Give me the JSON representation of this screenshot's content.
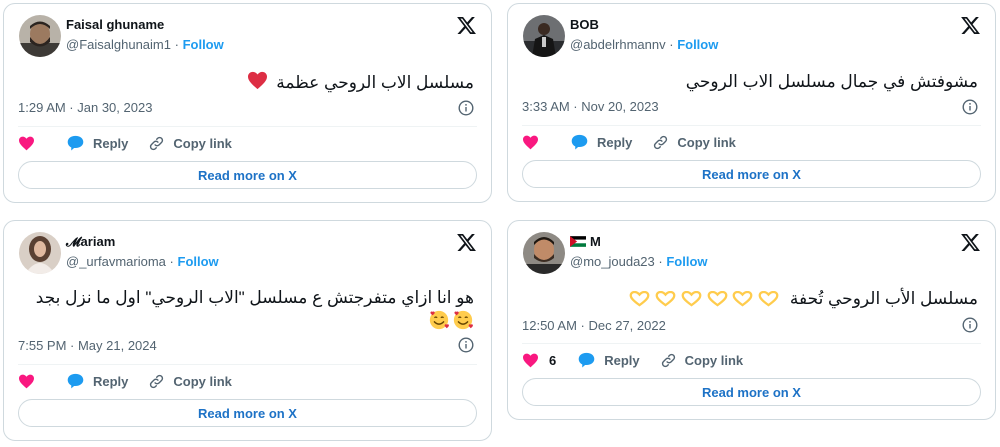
{
  "colors": {
    "heart": "#f91880",
    "reply_bubble": "#1d9bf0",
    "link": "#1d9bf0",
    "read_more_text": "#1d72c6",
    "muted": "#536471",
    "border": "#cfd9de"
  },
  "tweets": [
    {
      "name": "Faisal ghuname",
      "handle": "@Faisalghunaim1",
      "separator": "·",
      "follow": "Follow",
      "text": "مسلسل الاب الروحي عظمة",
      "emoji": "red-heart-emoji",
      "datetime": "1:29 AM · Jan 30, 2023",
      "likes": "",
      "reply": "Reply",
      "copy_link": "Copy link",
      "read_more": "Read more on X"
    },
    {
      "name": "BOB",
      "handle": "@abdelrhmannv",
      "separator": "·",
      "follow": "Follow",
      "text": "مشوفتش في جمال مسلسل الاب الروحي",
      "datetime": "3:33 AM · Nov 20, 2023",
      "likes": "",
      "reply": "Reply",
      "copy_link": "Copy link",
      "read_more": "Read more on X"
    },
    {
      "name": "𝓜ariam",
      "handle": "@_urfavmarioma",
      "separator": "·",
      "follow": "Follow",
      "text": "هو انا ازاي متفرجتش ع مسلسل \"الاب الروحي\" اول ما نزل بجد",
      "emoji": "smiling-face-with-hearts-emoji",
      "datetime": "7:55 PM · May 21, 2024",
      "likes": "",
      "reply": "Reply",
      "copy_link": "Copy link",
      "read_more": "Read more on X"
    },
    {
      "name": "M",
      "flag": "palestine-flag-icon",
      "handle": "@mo_jouda23",
      "separator": "·",
      "follow": "Follow",
      "text": "مسلسل الأب الروحي تُحفة",
      "emoji": "yellow-heart-hands-emoji",
      "datetime": "12:50 AM · Dec 27, 2022",
      "likes": "6",
      "reply": "Reply",
      "copy_link": "Copy link",
      "read_more": "Read more on X"
    }
  ]
}
